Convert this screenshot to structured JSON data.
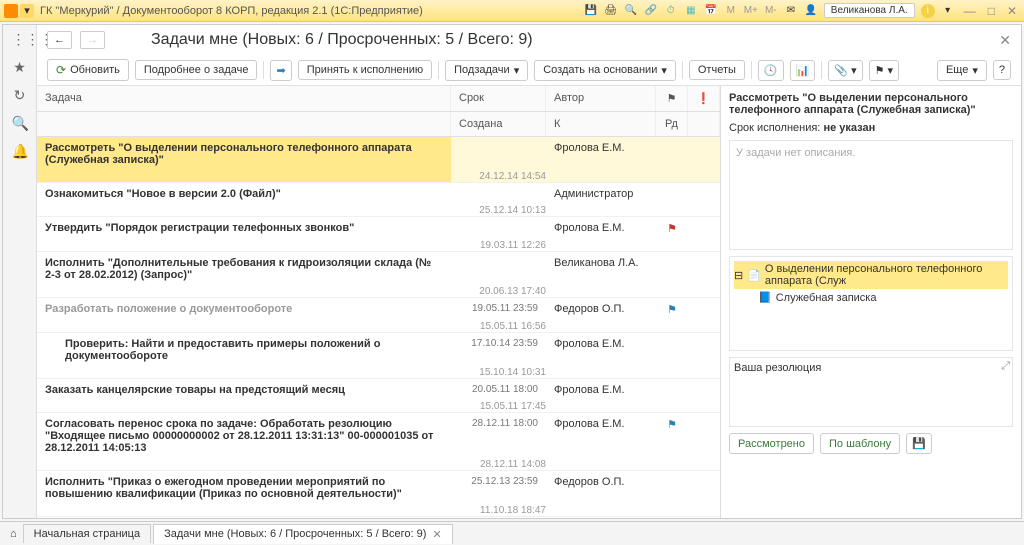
{
  "titlebar": {
    "title": "ГК \"Меркурий\" / Документооборот 8 КОРП, редакция 2.1   (1С:Предприятие)",
    "user": "Великанова Л.А.",
    "m": "M",
    "mplus": "M+",
    "mminus": "M-"
  },
  "nav": {
    "back": "←",
    "fwd": "→"
  },
  "heading": "Задачи мне (Новых: 6 / Просроченных: 5 / Всего: 9)",
  "toolbar": {
    "refresh": "Обновить",
    "more_task": "Подробнее о задаче",
    "accept": "Принять к исполнению",
    "subtasks": "Подзадачи",
    "create_on": "Создать на основании",
    "reports": "Отчеты",
    "more": "Еще",
    "help": "?"
  },
  "columns": {
    "task": "Задача",
    "date": "Срок",
    "author": "Автор",
    "created": "Создана",
    "k": "К",
    "rd": "Рд"
  },
  "rows": [
    {
      "task": "Рассмотреть \"О выделении персонального телефонного аппарата (Служебная записка)\"",
      "date": "",
      "author": "Фролова Е.М.",
      "created": "24.12.14 14:54",
      "hl": true
    },
    {
      "task": "Ознакомиться \"Новое в версии 2.0 (Файл)\"",
      "date": "",
      "author": "Администратор",
      "created": "25.12.14 10:13"
    },
    {
      "task": "Утвердить \"Порядок регистрации телефонных звонков\"",
      "date": "",
      "author": "Фролова Е.М.",
      "created": "19.03.11 12:26",
      "flag": "red"
    },
    {
      "task": "Исполнить \"Дополнительные требования к гидроизоляции склада (№ 2-3 от 28.02.2012) (Запрос)\"",
      "date": "",
      "author": "Великанова Л.А.",
      "created": "20.06.13 17:40"
    },
    {
      "task": "Разработать положение о документообороте",
      "date": "19.05.11 23:59",
      "author": "Федоров О.П.",
      "created": "15.05.11 16:56",
      "flag": "blue",
      "gray": true,
      "red": true
    },
    {
      "task": "Проверить: Найти и предоставить примеры положений о документообороте",
      "date": "17.10.14 23:59",
      "author": "Фролова Е.М.",
      "created": "15.10.14 10:31",
      "red": true,
      "indent": true
    },
    {
      "task": "Заказать канцелярские товары на предстоящий месяц",
      "date": "20.05.11 18:00",
      "author": "Фролова Е.М.",
      "created": "15.05.11 17:45",
      "red": true
    },
    {
      "task": "Согласовать перенос срока по задаче: Обработать резолюцию \"Входящее письмо 00000000002 от 28.12.2011 13:31:13\" 00-000001035 от 28.12.2011 14:05:13",
      "date": "28.12.11 18:00",
      "author": "Фролова Е.М.",
      "created": "28.12.11 14:08",
      "flag": "blue",
      "red": true
    },
    {
      "task": "Исполнить \"Приказ о ежегодном проведении мероприятий по повышению квалификации (Приказ по основной деятельности)\"",
      "date": "25.12.13 23:59",
      "author": "Федоров О.П.",
      "created": "11.10.18 18:47",
      "red": true
    }
  ],
  "detail": {
    "title": "Рассмотреть \"О выделении персонального телефонного аппарата (Служебная записка)\"",
    "due_label": "Срок исполнения:",
    "due_val": "не указан",
    "no_desc": "У задачи нет описания.",
    "tree1": "О выделении персонального телефонного аппарата (Служ",
    "tree2": "Служебная записка",
    "res_placeholder": "Ваша резолюция",
    "btn_reviewed": "Рассмотрено",
    "btn_template": "По шаблону"
  },
  "tabs": {
    "home": "Начальная страница",
    "current": "Задачи мне (Новых: 6 / Просроченных: 5 / Всего: 9)"
  }
}
